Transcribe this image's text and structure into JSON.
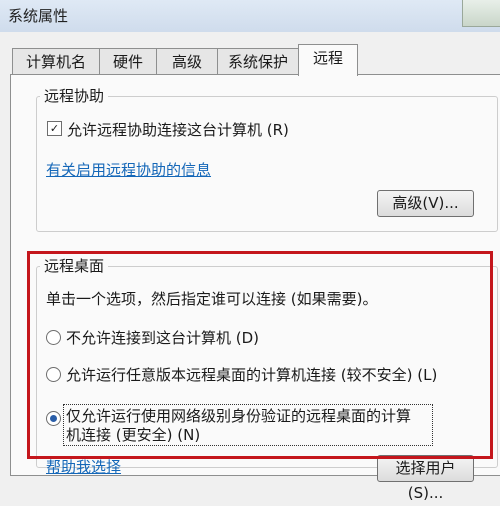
{
  "window": {
    "title": "系统属性"
  },
  "tabs": [
    {
      "label": "计算机名"
    },
    {
      "label": "硬件"
    },
    {
      "label": "高级"
    },
    {
      "label": "系统保护"
    },
    {
      "label": "远程"
    }
  ],
  "remote_assistance": {
    "title": "远程协助",
    "checkbox_label": "允许远程协助连接这台计算机 (R)",
    "checked": true,
    "link": "有关启用远程协助的信息",
    "advanced_button": "高级(V)..."
  },
  "remote_desktop": {
    "title": "远程桌面",
    "instruction": "单击一个选项，然后指定谁可以连接 (如果需要)。",
    "options": [
      {
        "label": "不允许连接到这台计算机 (D)",
        "selected": false
      },
      {
        "label": "允许运行任意版本远程桌面的计算机连接 (较不安全) (L)",
        "selected": false
      },
      {
        "label_line1": "仅允许运行使用网络级别身份验证的远程桌面的计算",
        "label_line2": "机连接 (更安全) (N)",
        "selected": true
      }
    ],
    "help_link": "帮助我选择",
    "select_users_button": "选择用户(S)..."
  },
  "colors": {
    "highlight_border": "#c4161c",
    "link": "#1467b8",
    "radio_dot": "#2a5ea8"
  }
}
